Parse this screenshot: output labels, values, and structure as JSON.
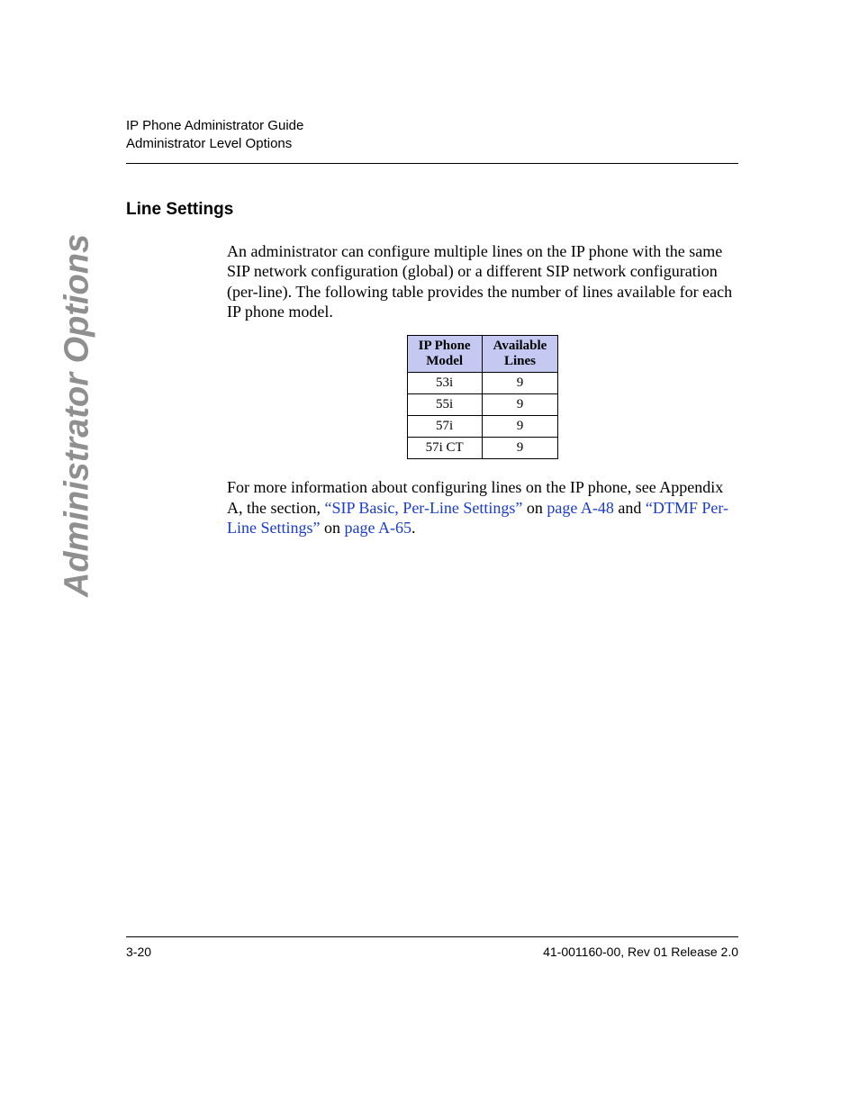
{
  "header": {
    "line1": "IP Phone Administrator Guide",
    "line2": "Administrator Level Options"
  },
  "side_label": "Administrator Options",
  "section": {
    "heading": "Line Settings",
    "para1": "An administrator can configure multiple lines on the IP phone with the same SIP network configuration (global) or a different SIP network configuration (per-line). The following table provides the number of lines available for each IP phone model.",
    "para2_pre": "For more information about configuring lines on the IP phone, see Appendix A, the section, ",
    "link1": "“SIP Basic, Per-Line Settings”",
    "para2_on": " on ",
    "link2": "page A-48",
    "para2_and": " and ",
    "link3": "“DTMF Per-Line Settings”",
    "para2_on2": " on ",
    "link4": "page A-65",
    "para2_end": "."
  },
  "table": {
    "head_col1_l1": "IP Phone",
    "head_col1_l2": "Model",
    "head_col2_l1": "Available",
    "head_col2_l2": "Lines",
    "rows": [
      {
        "model": "53i",
        "lines": "9"
      },
      {
        "model": "55i",
        "lines": "9"
      },
      {
        "model": "57i",
        "lines": "9"
      },
      {
        "model": "57i CT",
        "lines": "9"
      }
    ]
  },
  "footer": {
    "page": "3-20",
    "doc": "41-001160-00, Rev 01 Release 2.0"
  },
  "chart_data": {
    "type": "table",
    "title": "Line Settings — Available Lines per IP Phone Model",
    "columns": [
      "IP Phone Model",
      "Available Lines"
    ],
    "rows": [
      [
        "53i",
        9
      ],
      [
        "55i",
        9
      ],
      [
        "57i",
        9
      ],
      [
        "57i CT",
        9
      ]
    ]
  }
}
